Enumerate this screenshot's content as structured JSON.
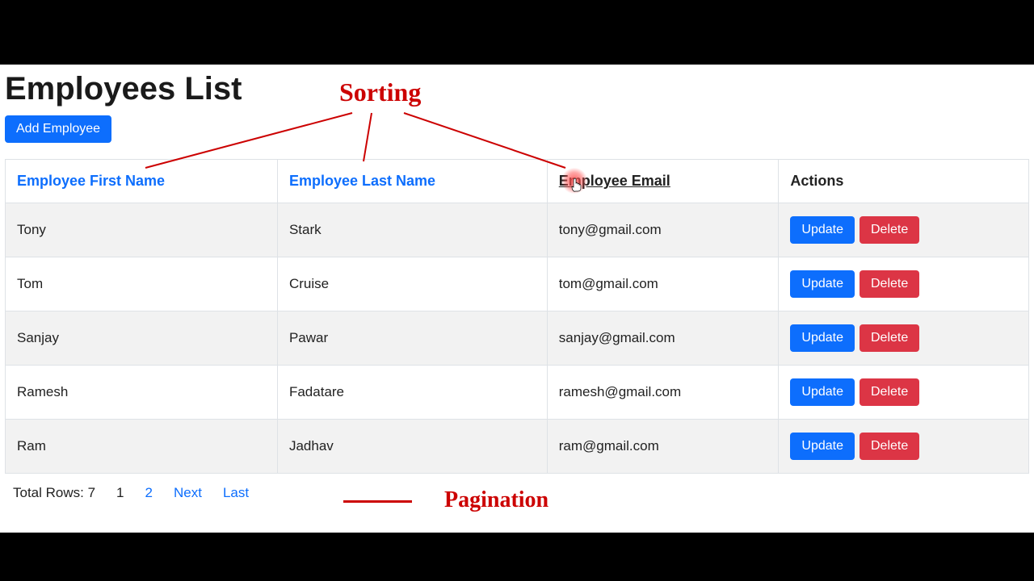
{
  "page": {
    "title": "Employees List",
    "add_button": "Add Employee"
  },
  "annotations": {
    "sorting": "Sorting",
    "pagination": "Pagination"
  },
  "table": {
    "headers": {
      "first_name": "Employee First Name",
      "last_name": "Employee Last Name",
      "email": "Employee Email",
      "actions": "Actions"
    },
    "action_labels": {
      "update": "Update",
      "delete": "Delete"
    },
    "rows": [
      {
        "first_name": "Tony",
        "last_name": "Stark",
        "email": "tony@gmail.com"
      },
      {
        "first_name": "Tom",
        "last_name": "Cruise",
        "email": "tom@gmail.com"
      },
      {
        "first_name": "Sanjay",
        "last_name": "Pawar",
        "email": "sanjay@gmail.com"
      },
      {
        "first_name": "Ramesh",
        "last_name": "Fadatare",
        "email": "ramesh@gmail.com"
      },
      {
        "first_name": "Ram",
        "last_name": "Jadhav",
        "email": "ram@gmail.com"
      }
    ]
  },
  "pagination": {
    "total_label": "Total Rows: 7",
    "pages": [
      {
        "label": "1",
        "current": true
      },
      {
        "label": "2",
        "current": false
      }
    ],
    "next": "Next",
    "last": "Last"
  }
}
